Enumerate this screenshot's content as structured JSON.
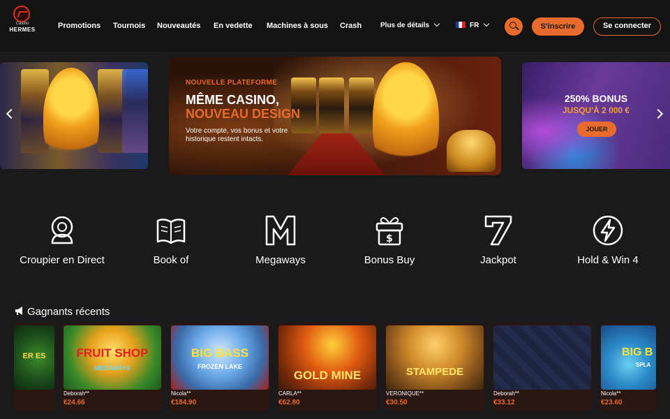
{
  "logo": {
    "sub": "Casino",
    "name": "HERMES"
  },
  "nav": {
    "items": [
      "Promotions",
      "Tournois",
      "Nouveautés",
      "En vedette",
      "Machines à sous",
      "Crash"
    ],
    "more": "Plus de détails",
    "lang": "FR"
  },
  "header": {
    "register": "S'inscrire",
    "login": "Se connecter"
  },
  "icons": {
    "search": "search-icon",
    "arrow_left": "chevron-left-icon",
    "arrow_right": "chevron-right-icon"
  },
  "banner_main": {
    "tag": "NOUVELLE PLATEFORME",
    "title1": "MÊME CASINO,",
    "title2": "NOUVEAU DESIGN",
    "desc": "Votre compte, vos bonus et votre historique restent intacts."
  },
  "banner_right": {
    "title": "250% BONUS",
    "sub": "JUSQU'À 2 000 €",
    "button": "JOUER"
  },
  "categories": [
    {
      "label": "Croupier en Direct",
      "icon": "dealer-icon"
    },
    {
      "label": "Book of",
      "icon": "book-icon"
    },
    {
      "label": "Megaways",
      "icon": "megaways-m-icon"
    },
    {
      "label": "Bonus Buy",
      "icon": "gift-dollar-icon"
    },
    {
      "label": "Jackpot",
      "icon": "seven-icon"
    },
    {
      "label": "Hold & Win 4",
      "icon": "lightning-icon"
    }
  ],
  "winners": {
    "title": "Gagnants récents",
    "items": [
      {
        "name": "Deborah**",
        "amount": "€24.66",
        "game": "FRUIT SHOP",
        "game_sub": "MEGAWAYS"
      },
      {
        "name": "Nicola**",
        "amount": "€184.90",
        "game": "BIG BASS",
        "game_sub": "FROZEN LAKE"
      },
      {
        "name": "CARLA**",
        "amount": "€62.80",
        "game": "GOLD MINE",
        "game_sub": ""
      },
      {
        "name": "VERONIQUE**",
        "amount": "€30.50",
        "game": "STAMPEDE",
        "game_sub": ""
      },
      {
        "name": "Deborah**",
        "amount": "€33.12",
        "game": "",
        "game_sub": ""
      },
      {
        "name": "Nicola**",
        "amount": "€23.60",
        "game": "BIG B",
        "game_sub": "SPLA"
      }
    ],
    "partial_left_game": "ER ES"
  },
  "colors": {
    "accent": "#e86a2c",
    "bg": "#1a1a1a",
    "header": "#131313",
    "card": "#2a1712"
  }
}
